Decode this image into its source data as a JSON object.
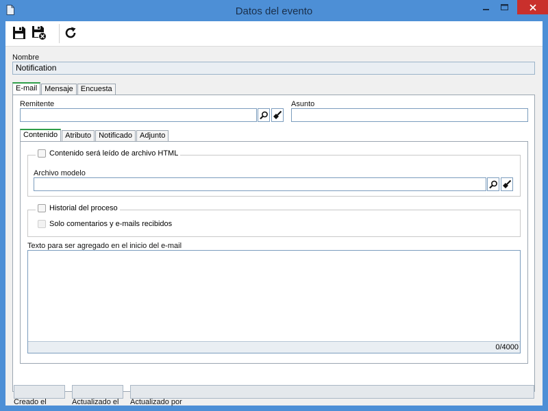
{
  "window": {
    "title": "Datos del evento"
  },
  "form": {
    "nombre_label": "Nombre",
    "nombre_value": "Notification"
  },
  "outer_tabs": [
    {
      "label": "E-mail",
      "active": true
    },
    {
      "label": "Mensaje",
      "active": false
    },
    {
      "label": "Encuesta",
      "active": false
    }
  ],
  "email": {
    "remitente_label": "Remitente",
    "remitente_value": "",
    "asunto_label": "Asunto",
    "asunto_value": ""
  },
  "inner_tabs": [
    {
      "label": "Contenido",
      "active": true
    },
    {
      "label": "Atributo",
      "active": false
    },
    {
      "label": "Notificado",
      "active": false
    },
    {
      "label": "Adjunto",
      "active": false
    }
  ],
  "contenido": {
    "html_checkbox_label": "Contenido será leído de archivo HTML",
    "html_checked": false,
    "archivo_modelo_label": "Archivo modelo",
    "archivo_modelo_value": "",
    "historial_checkbox_label": "Historial del proceso",
    "historial_checked": false,
    "solo_comentarios_label": "Solo comentarios y e-mails recibidos",
    "solo_comentarios_checked": false,
    "texto_label": "Texto para ser agregado en el inicio del e-mail",
    "texto_value": "",
    "counter": "0/4000"
  },
  "footer": {
    "creado_label": "Creado el",
    "creado_value": "",
    "actualizado_label": "Actualizado el",
    "actualizado_value": "",
    "actualizado_por_label": "Actualizado por",
    "actualizado_por_value": ""
  },
  "colors": {
    "titlebar": "#4d8fd6",
    "close_button": "#c9302c",
    "active_tab_accent": "#2e9e48",
    "field_border": "#7a9cbd"
  }
}
